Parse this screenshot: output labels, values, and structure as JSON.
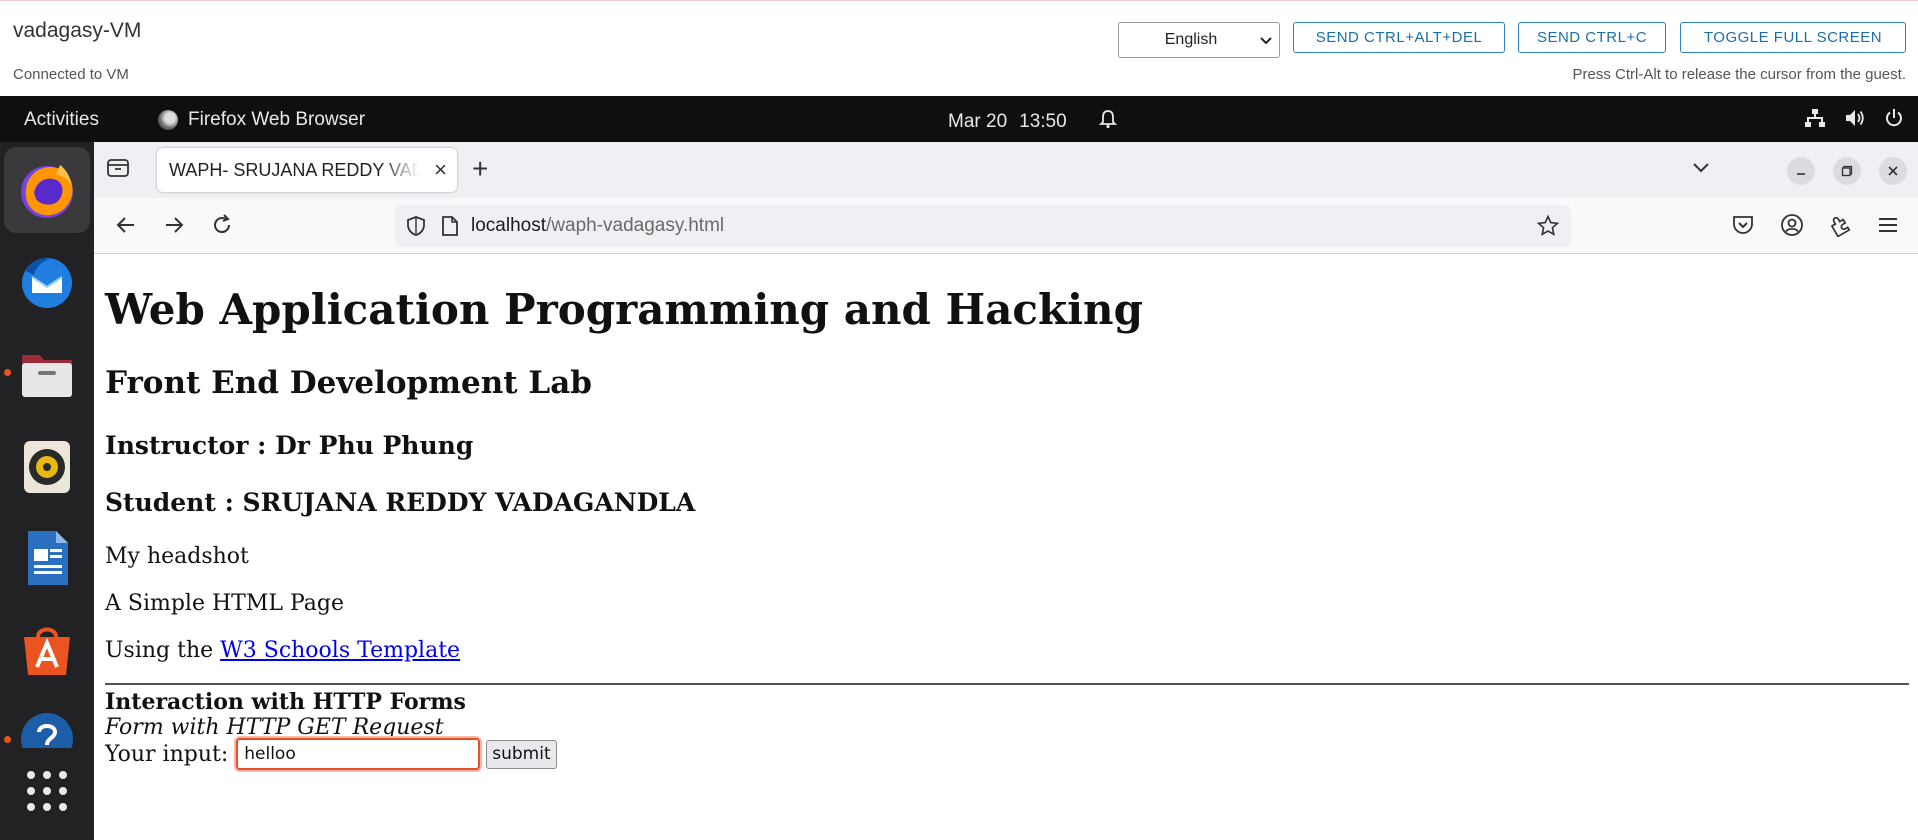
{
  "vm": {
    "title": "vadagasy-VM",
    "status": "Connected to VM",
    "hint": "Press Ctrl-Alt to release the cursor from the guest.",
    "language": "English",
    "buttons": {
      "ctrl_alt_del": "SEND CTRL+ALT+DEL",
      "ctrl_c": "SEND CTRL+C",
      "fullscreen": "TOGGLE FULL SCREEN"
    }
  },
  "topbar": {
    "activities": "Activities",
    "app_name": "Firefox Web Browser",
    "date": "Mar 20",
    "time": "13:50"
  },
  "dock": {
    "items": [
      "firefox-icon",
      "thunderbird-icon",
      "files-icon",
      "rhythmbox-icon",
      "libreoffice-writer-icon",
      "app-center-icon",
      "help-icon",
      "show-apps-icon"
    ]
  },
  "browser": {
    "tab_title": "WAPH- SRUJANA REDDY VADAGANDLA",
    "url_host": "localhost",
    "url_path": "/waph-vadagasy.html"
  },
  "page": {
    "h1": "Web Application Programming and Hacking",
    "h2": "Front End Development Lab",
    "instructor": "Instructor : Dr Phu Phung",
    "student": "Student : SRUJANA REDDY VADAGANDLA",
    "headshot": "My headshot",
    "simple": "A Simple HTML Page",
    "using_prefix": "Using the ",
    "link_text": "W3 Schools Template",
    "form_title": "Interaction with HTTP Forms",
    "form_subtitle": "Form with HTTP GET Request",
    "input_label": "Your input:",
    "input_value": "helloo",
    "submit_label": "submit"
  },
  "colors": {
    "accent_orange": "#e95420",
    "focus_ring": "#e4502a",
    "link": "#0000ee",
    "vm_button": "#1c6ea9"
  }
}
